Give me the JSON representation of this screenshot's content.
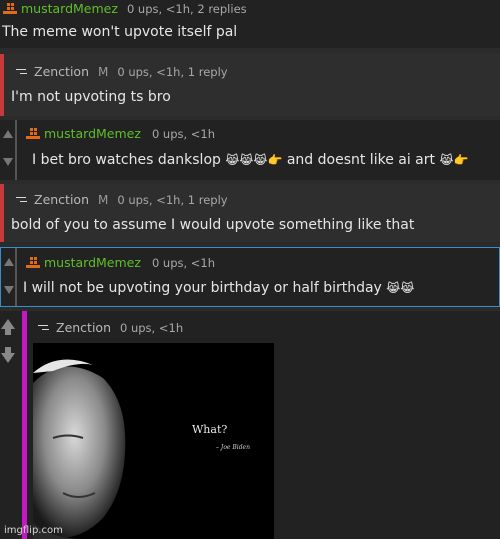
{
  "comments": [
    {
      "user": "mustardMemez",
      "badge": "",
      "stats": "0 ups, <1h, 2 replies",
      "text": "The meme won't upvote itself pal"
    },
    {
      "user": "Zenction",
      "badge": "M",
      "stats": "0 ups, <1h, 1 reply",
      "text": "I'm not upvoting ts bro"
    },
    {
      "user": "mustardMemez",
      "badge": "",
      "stats": "0 ups, <1h",
      "text": "I bet bro watches dankslop",
      "text_mid": "and doesnt like ai art"
    },
    {
      "user": "Zenction",
      "badge": "M",
      "stats": "0 ups, <1h, 1 reply",
      "text": "bold of you to assume I would upvote something like that"
    },
    {
      "user": "mustardMemez",
      "badge": "",
      "stats": "0 ups, <1h",
      "text": "I will not be upvoting your birthday or half birthday"
    },
    {
      "user": "Zenction",
      "badge": "",
      "stats": "0 ups, <1h",
      "text": ""
    }
  ],
  "meme_image": {
    "caption": "What?",
    "attribution": "– Joe Biden"
  },
  "watermark": "imgflip.com",
  "icons": {
    "avatar_mustard": "pixel-face-icon",
    "avatar_zenction": "dash-icon",
    "emoji_laugh": "laughing-cat-emoji",
    "emoji_point": "pointing-hand-emoji",
    "upvote": "up-arrow-icon",
    "downvote": "down-arrow-icon"
  },
  "colors": {
    "green_user": "#5fbf2a",
    "red_bar": "#c83a3a",
    "blue_outline": "#3a8fc8",
    "magenta_bar": "#c518c5",
    "background": "#2b2b2b"
  }
}
